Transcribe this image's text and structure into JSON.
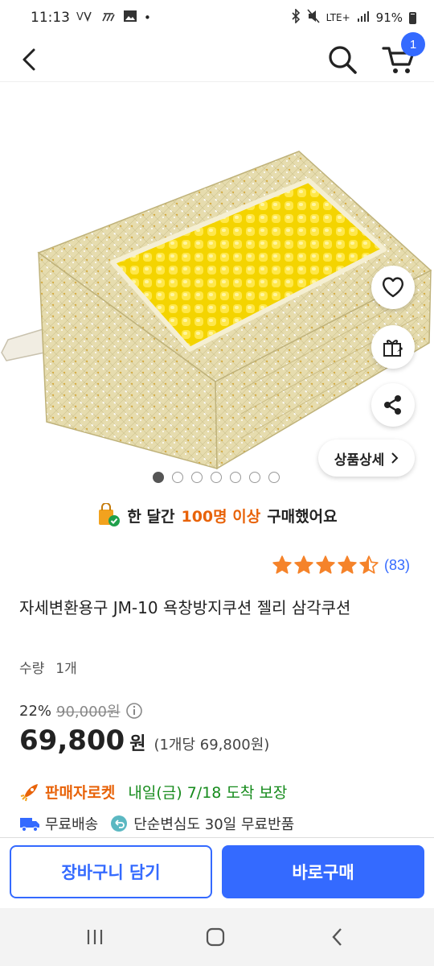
{
  "status_bar": {
    "time": "11:13",
    "network": "LTE+",
    "battery": "91%"
  },
  "header": {
    "cart_count": "1"
  },
  "gallery": {
    "image_count": 7,
    "active_index": 0,
    "detail_button_label": "상품상세"
  },
  "purchase_message": {
    "prefix": "한 달간",
    "highlight": "100명 이상",
    "suffix": "구매했어요"
  },
  "rating": {
    "stars": 4.5,
    "review_count": "(83)"
  },
  "product": {
    "title": "자세변환용구 JM-10 욕창방지쿠션 젤리 삼각쿠션",
    "quantity_label": "수량",
    "quantity_value": "1개"
  },
  "price": {
    "discount": "22%",
    "original": "90,000원",
    "current": "69,800",
    "currency": "원",
    "unit_price": "(1개당 69,800원)"
  },
  "delivery": {
    "badge": "판매자로켓",
    "arrival": "내일(금) 7/18 도착 보장",
    "free_shipping": "무료배송",
    "returns": "단순변심도 30일 무료반품"
  },
  "actions": {
    "add_to_cart": "장바구니 담기",
    "buy_now": "바로구매"
  },
  "colors": {
    "accent": "#346aff",
    "highlight": "#e8630a",
    "delivery_green": "#168b1c",
    "star": "#f5832a"
  }
}
